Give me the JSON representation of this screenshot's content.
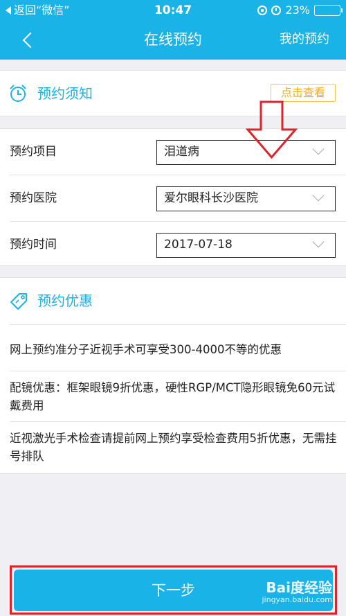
{
  "status_bar": {
    "back_app": "返回“微信”",
    "time": "10:47",
    "battery": "23%",
    "battery_level": 0.23
  },
  "nav": {
    "title": "在线预约",
    "my_booking": "我的预约"
  },
  "notice": {
    "title": "预约须知",
    "view_label": "点击查看"
  },
  "form": {
    "rows": [
      {
        "label": "预约项目",
        "value": "泪道病"
      },
      {
        "label": "预约医院",
        "value": "爱尔眼科长沙医院"
      },
      {
        "label": "预约时间",
        "value": "2017-07-18"
      }
    ]
  },
  "promo": {
    "title": "预约优惠",
    "items": [
      "网上预约准分子近视手术可享受300-4000不等的优惠",
      "配镜优惠：框架眼镜9折优惠，硬性RGP/MCT隐形眼镜免60元试戴费用",
      "近视激光手术检查请提前网上预约享受检查费用5折优惠，无需挂号排队"
    ]
  },
  "footer": {
    "next_label": "下一步"
  },
  "watermark": {
    "main": "Bai度经验",
    "sub": "jingyan.baidu.com"
  },
  "colors": {
    "brand": "#1ab3e8",
    "annotation": "#d9262d",
    "notice_button": "#f2a81a"
  }
}
